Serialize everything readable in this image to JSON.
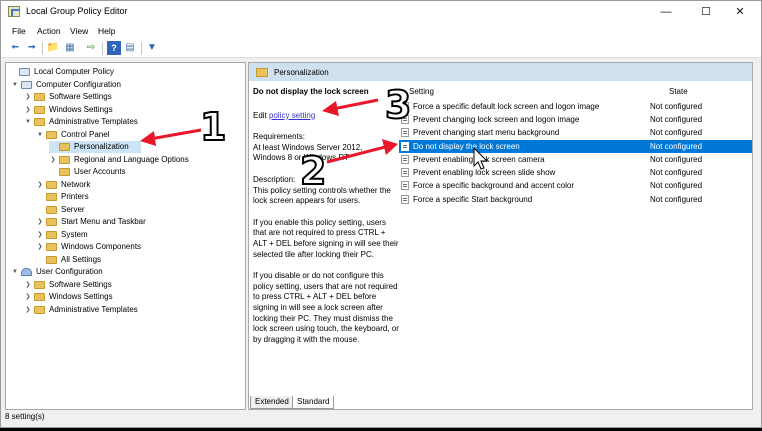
{
  "window": {
    "title": "Local Group Policy Editor"
  },
  "menu": [
    "File",
    "Action",
    "View",
    "Help"
  ],
  "toolbar_icons": [
    "back-icon",
    "forward-icon",
    "up-folder-icon",
    "show-hide-tree-icon",
    "export-list-icon",
    "help-icon",
    "properties-icon",
    "filter-icon"
  ],
  "tree": [
    {
      "label": "Local Computer Policy",
      "expanded": true
    },
    {
      "label": "Computer Configuration",
      "expanded": true
    },
    {
      "label": "Software Settings"
    },
    {
      "label": "Windows Settings"
    },
    {
      "label": "Administrative Templates",
      "expanded": true
    },
    {
      "label": "Control Panel",
      "expanded": true
    },
    {
      "label": "Personalization",
      "selected": true
    },
    {
      "label": "Regional and Language Options"
    },
    {
      "label": "User Accounts"
    },
    {
      "label": "Network"
    },
    {
      "label": "Printers"
    },
    {
      "label": "Server"
    },
    {
      "label": "Start Menu and Taskbar"
    },
    {
      "label": "System"
    },
    {
      "label": "Windows Components"
    },
    {
      "label": "All Settings"
    },
    {
      "label": "User Configuration",
      "expanded": true
    },
    {
      "label": "Software Settings"
    },
    {
      "label": "Windows Settings"
    },
    {
      "label": "Administrative Templates"
    }
  ],
  "panel": {
    "header": "Personalization",
    "desc_title": "Do not display the lock screen",
    "edit_prefix": "Edit",
    "edit_link": "policy setting",
    "requirements_label": "Requirements:",
    "requirements_1": "At least Windows Server 2012,",
    "requirements_2": "Windows 8 or Windows RT",
    "description_label": "Description:",
    "description_1": "This policy setting controls whether the lock screen appears for users.",
    "description_2": "If you enable this policy setting, users that are not required to press CTRL + ALT + DEL before signing in will see their selected tile after locking their PC.",
    "description_3": "If you disable or do not configure this policy setting, users that are not required to press CTRL + ALT + DEL before signing in will see a lock screen after locking their PC. They must dismiss the lock screen using touch, the keyboard, or by dragging it with the mouse."
  },
  "table": {
    "col_setting": "Setting",
    "col_state": "State",
    "rows": [
      {
        "name": "Force a specific default lock screen and logon image",
        "state": "Not configured"
      },
      {
        "name": "Prevent changing lock screen and logon image",
        "state": "Not configured"
      },
      {
        "name": "Prevent changing start menu background",
        "state": "Not configured"
      },
      {
        "name": "Do not display the lock screen",
        "state": "Not configured",
        "selected": true
      },
      {
        "name": "Prevent enabling lock screen camera",
        "state": "Not configured"
      },
      {
        "name": "Prevent enabling lock screen slide show",
        "state": "Not configured"
      },
      {
        "name": "Force a specific background and accent color",
        "state": "Not configured"
      },
      {
        "name": "Force a specific Start background",
        "state": "Not configured"
      }
    ]
  },
  "tabs": [
    "Extended",
    "Standard"
  ],
  "status": "8 setting(s)",
  "annotations": [
    "1",
    "2",
    "3"
  ],
  "colors": {
    "selection": "#0078d7",
    "header": "#cfe0ef",
    "arrow": "#e8182a"
  }
}
